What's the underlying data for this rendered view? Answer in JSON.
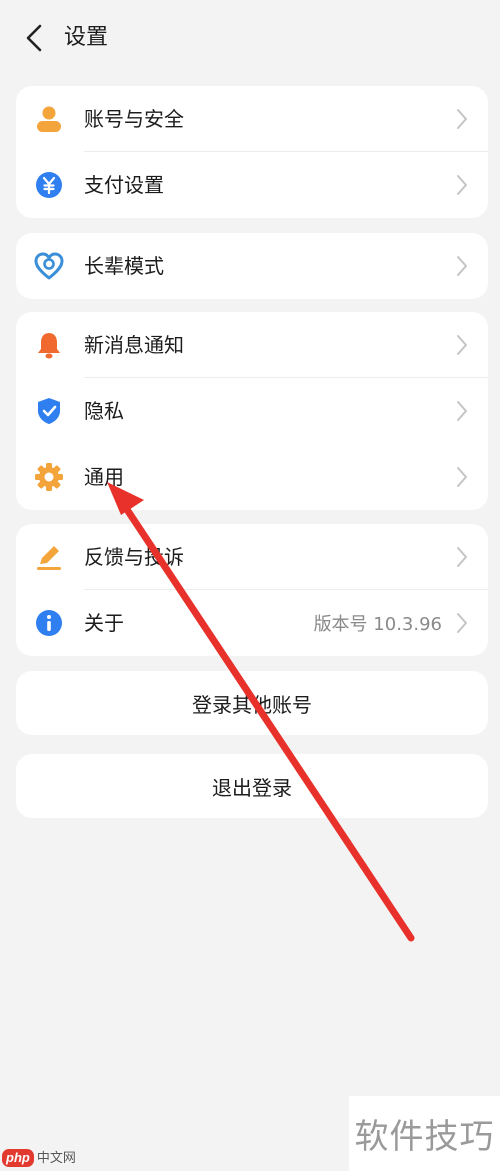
{
  "header": {
    "title": "设置",
    "back_icon": "chevron-left-icon"
  },
  "groups": [
    {
      "items": [
        {
          "label": "账号与安全",
          "icon": "user-icon",
          "icon_color": "#f3a43a"
        },
        {
          "label": "支付设置",
          "icon": "yuan-icon",
          "icon_color": "#2f7ff0"
        }
      ]
    },
    {
      "items": [
        {
          "label": "长辈模式",
          "icon": "heart-icon",
          "icon_color": "#3a8fd8"
        }
      ]
    },
    {
      "items": [
        {
          "label": "新消息通知",
          "icon": "bell-icon",
          "icon_color": "#f06a30"
        },
        {
          "label": "隐私",
          "icon": "shield-icon",
          "icon_color": "#2f7ff0"
        },
        {
          "label": "通用",
          "icon": "gear-icon",
          "icon_color": "#f3a43a"
        }
      ]
    },
    {
      "items": [
        {
          "label": "反馈与投诉",
          "icon": "pencil-icon",
          "icon_color": "#f3a43a"
        },
        {
          "label": "关于",
          "icon": "info-icon",
          "icon_color": "#2f7ff0",
          "value": "版本号 10.3.96"
        }
      ]
    }
  ],
  "buttons": {
    "switch_account": "登录其他账号",
    "logout": "退出登录"
  },
  "annotation": {
    "arrow_color": "#e8312a"
  },
  "watermarks": {
    "left_logo": "php",
    "left_text": "中文网",
    "right_text": "软件技巧"
  }
}
